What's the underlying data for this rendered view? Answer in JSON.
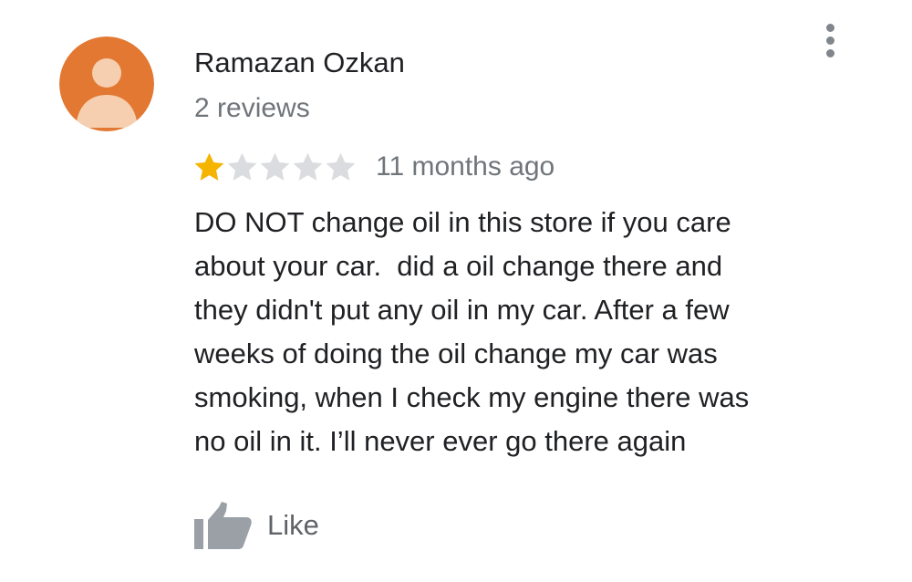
{
  "review": {
    "author": "Ramazan Ozkan",
    "review_count": "2 reviews",
    "rating": 1,
    "rating_max": 5,
    "timestamp": "11 months ago",
    "text_lines": [
      "DO NOT change oil in this store if you care",
      "about your car.  did a oil change there and",
      "they didn't put any oil in my car. After a few",
      "weeks of doing the oil change my car was",
      "smoking, when I check my engine there was",
      "no oil in it. I’ll never ever go there again"
    ]
  },
  "actions": {
    "like_label": "Like"
  },
  "icons": {
    "avatar": "person-placeholder-icon",
    "star_filled": "star-filled-icon",
    "star_empty": "star-empty-icon",
    "more": "more-vert-icon",
    "like": "thumbs-up-icon"
  },
  "colors": {
    "avatar_background": "#E27832",
    "avatar_figure": "#F5CFAF",
    "star_filled": "#F4B400",
    "star_empty": "#DADCE0",
    "secondary_text": "#70757A",
    "icon_gray": "#9AA0A6"
  }
}
